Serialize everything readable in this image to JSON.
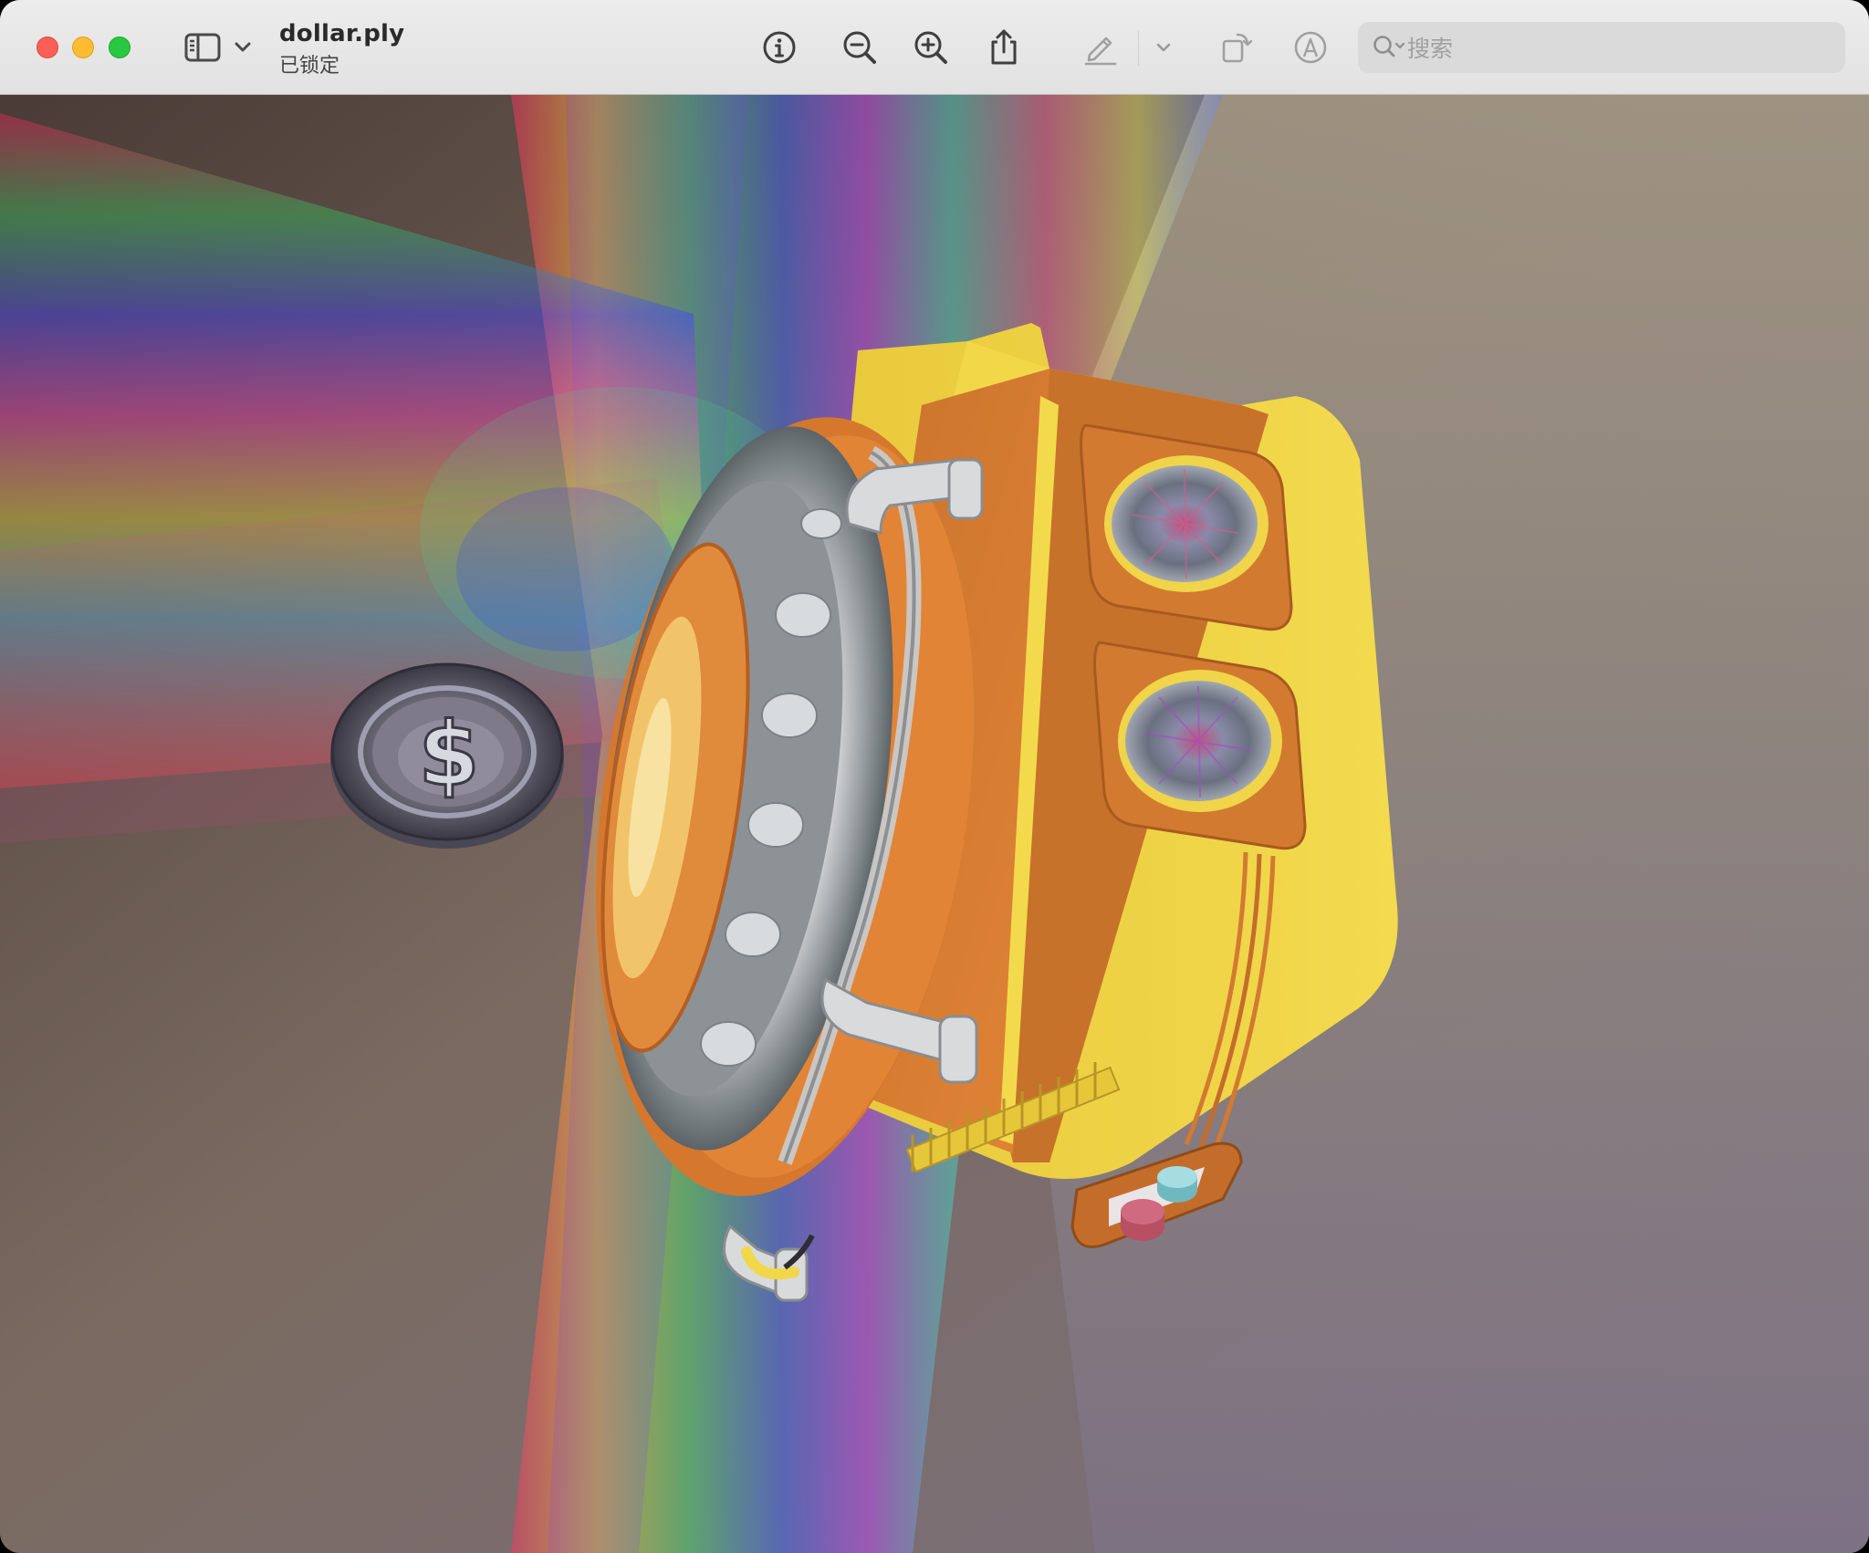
{
  "window": {
    "document_title": "dollar.ply",
    "document_status": "已锁定"
  },
  "toolbar": {
    "buttons": [
      {
        "name": "sidebar-toggle",
        "icon": "sidebar-icon"
      },
      {
        "name": "sidebar-menu",
        "icon": "chevron-down-icon"
      },
      {
        "name": "info",
        "icon": "info-icon"
      },
      {
        "name": "zoom-out",
        "icon": "zoom-out-icon"
      },
      {
        "name": "zoom-in",
        "icon": "zoom-in-icon"
      },
      {
        "name": "share",
        "icon": "share-icon"
      },
      {
        "name": "markup",
        "icon": "pencil-icon"
      },
      {
        "name": "markup-menu",
        "icon": "chevron-down-icon"
      },
      {
        "name": "rotate",
        "icon": "rotate-icon"
      },
      {
        "name": "annotate",
        "icon": "markup-circle-icon"
      }
    ],
    "search": {
      "placeholder": "搜索",
      "value": ""
    }
  },
  "scene": {
    "model_colors": {
      "body_yellow": "#f1d64a",
      "body_orange": "#d97a2e",
      "glass": "#bfc3c6",
      "background_top": "#5a4a44",
      "background_bottom": "#7b7280"
    }
  }
}
